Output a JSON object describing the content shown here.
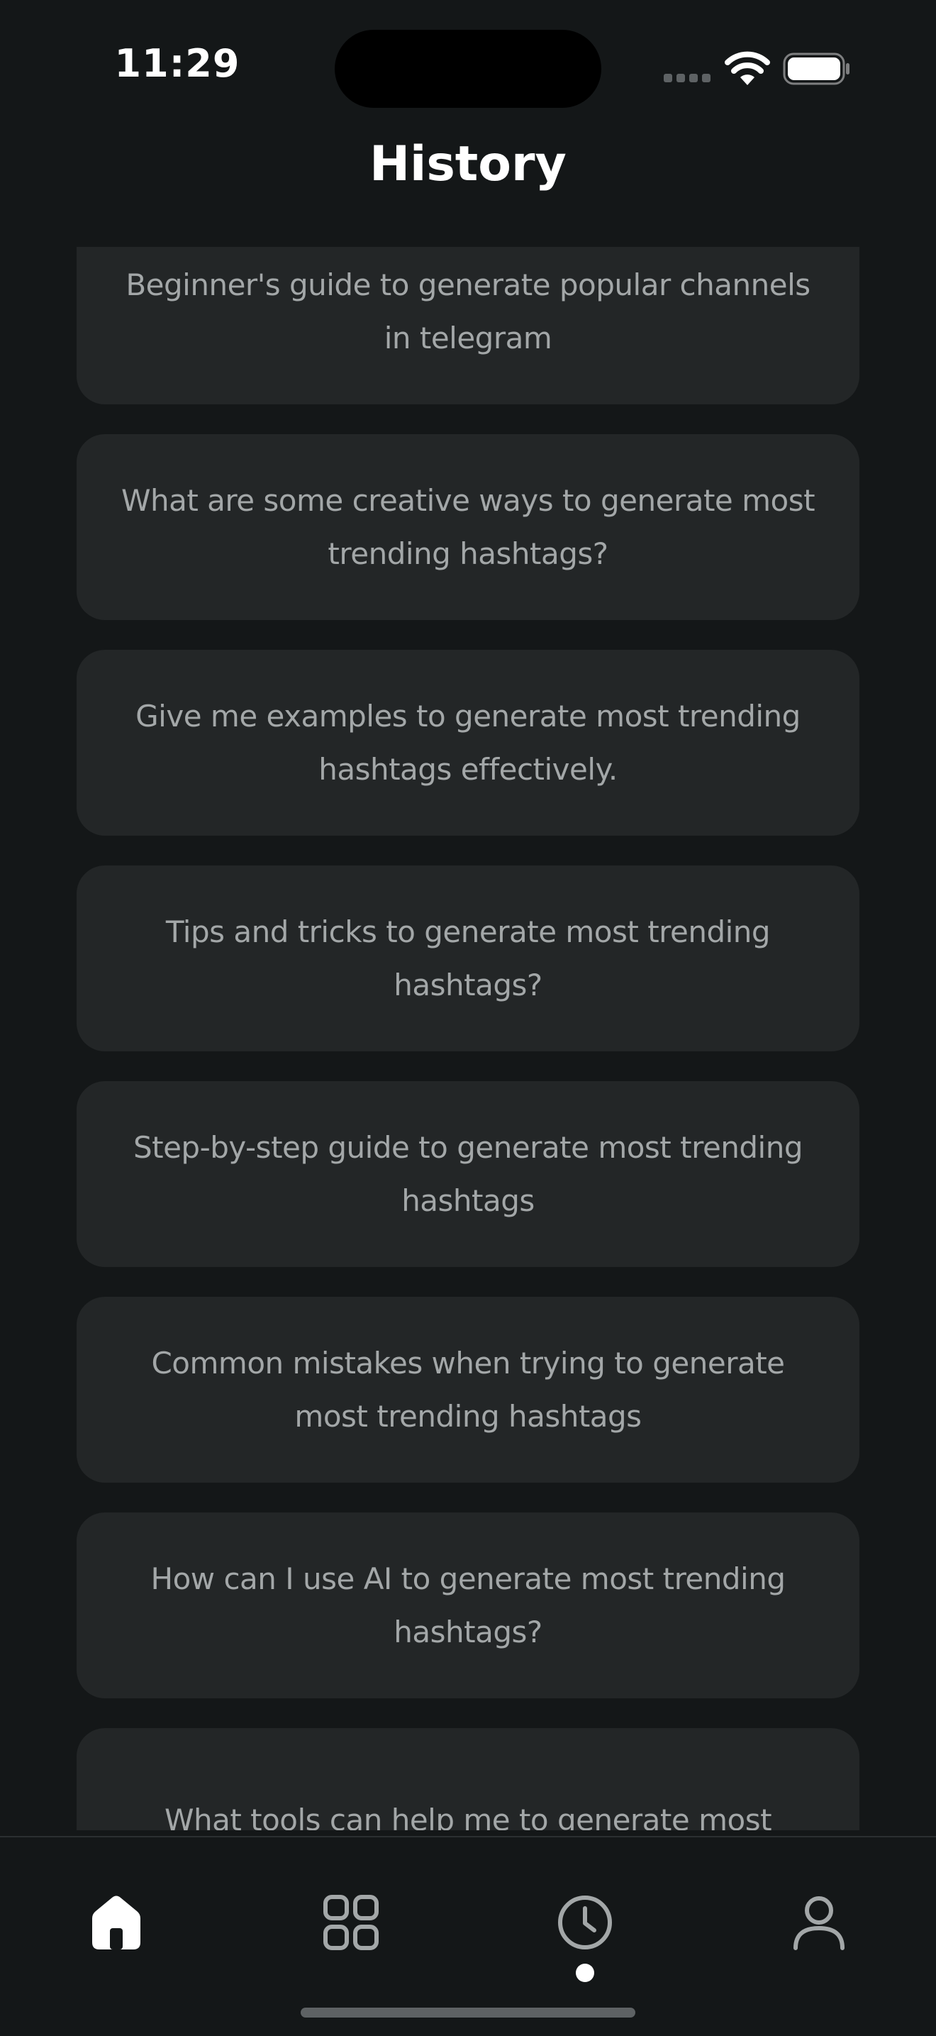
{
  "status_bar": {
    "time": "11:29",
    "icons": [
      "signal-icon",
      "wifi-icon",
      "battery-icon"
    ]
  },
  "header": {
    "title": "History"
  },
  "history": {
    "items": [
      {
        "label": "Beginner's guide to generate popular channels in telegram"
      },
      {
        "label": "What are some creative ways to generate most trending hashtags?"
      },
      {
        "label": "Give me examples to generate most trending hashtags effectively."
      },
      {
        "label": "Tips and tricks to generate most trending hashtags?"
      },
      {
        "label": "Step-by-step guide to generate most trending hashtags"
      },
      {
        "label": "Common mistakes when trying to generate most trending hashtags"
      },
      {
        "label": "How can I use AI to generate most trending hashtags?"
      },
      {
        "label": "What tools can help me to generate most trending"
      }
    ]
  },
  "bottom_nav": {
    "items": [
      {
        "icon": "home-icon",
        "active": false
      },
      {
        "icon": "apps-grid-icon",
        "active": false
      },
      {
        "icon": "clock-icon",
        "active": true
      },
      {
        "icon": "user-icon",
        "active": false
      }
    ]
  },
  "colors": {
    "background": "#141718",
    "card": "#232627",
    "card_text": "#a3a7a8",
    "title": "#ffffff"
  }
}
